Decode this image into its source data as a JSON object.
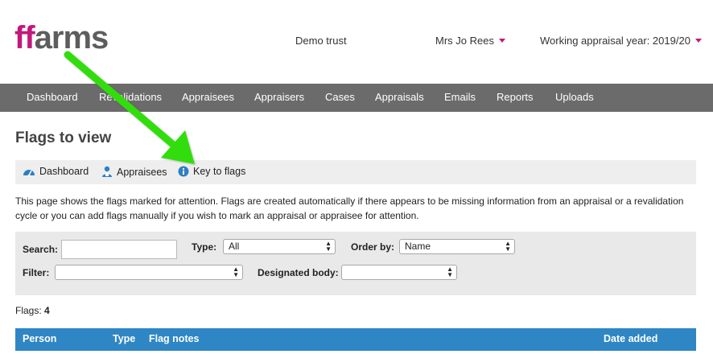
{
  "logo": {
    "part1": "ff",
    "part2": "arms"
  },
  "header": {
    "trust": "Demo trust",
    "user": "Mrs Jo Rees",
    "appraisal_year": "Working appraisal year: 2019/20"
  },
  "nav": {
    "items": [
      "Dashboard",
      "Revalidations",
      "Appraisees",
      "Appraisers",
      "Cases",
      "Appraisals",
      "Emails",
      "Reports",
      "Uploads"
    ]
  },
  "page": {
    "title": "Flags to view",
    "intro": "This page shows the flags marked for attention. Flags are created automatically if there appears to be missing information from an appraisal or a revalidation cycle or you can add flags manually if you wish to mark an appraisal or appraisee for attention."
  },
  "subnav": {
    "items": [
      {
        "label": "Dashboard",
        "icon": "dashboard-icon"
      },
      {
        "label": "Appraisees",
        "icon": "appraisees-icon"
      },
      {
        "label": "Key to flags",
        "icon": "info-icon"
      }
    ]
  },
  "filters": {
    "search_label": "Search:",
    "search_value": "",
    "type_label": "Type:",
    "type_value": "All",
    "order_label": "Order by:",
    "order_value": "Name",
    "filter_label": "Filter:",
    "filter_value": "",
    "body_label": "Designated body:",
    "body_value": ""
  },
  "flags": {
    "label": "Flags: ",
    "count": "4"
  },
  "table": {
    "columns": [
      "Person",
      "Type",
      "Flag notes",
      "Date added"
    ]
  },
  "colors": {
    "brand_pink": "#c2187b",
    "nav_bg": "#6b6b6b",
    "table_header_bg": "#2f86c4",
    "annotation_arrow": "#33dd11"
  }
}
